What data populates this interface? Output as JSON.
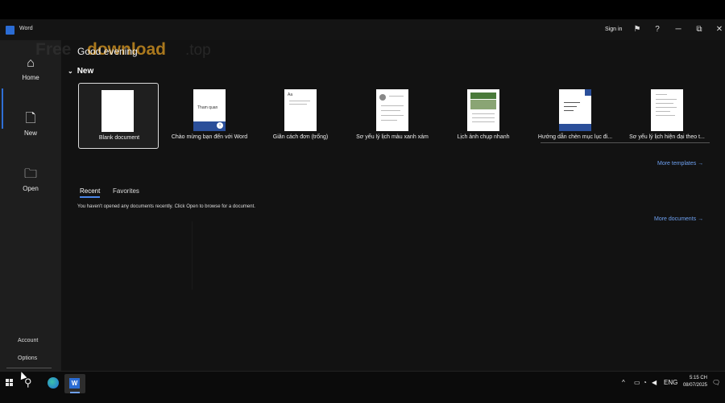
{
  "titlebar": {
    "app_name": "Word",
    "sign_in": "Sign in",
    "help_icon": "?",
    "minimize_icon": "─",
    "restore_icon": "⧉",
    "close_icon": "✕",
    "feedback_icon": "⚑"
  },
  "watermark": {
    "brand": "download",
    "prefix": "Free",
    "suffix": ".top"
  },
  "sidebar": {
    "items": [
      {
        "label": "Home",
        "icon": "home-icon",
        "glyph": "⌂"
      },
      {
        "label": "New",
        "icon": "new-document-icon",
        "glyph": "🗋"
      },
      {
        "label": "Open",
        "icon": "folder-icon",
        "glyph": "🗀"
      }
    ],
    "account": "Account",
    "options": "Options"
  },
  "main": {
    "greeting": "Good evening",
    "new_heading": "New",
    "new_chevron": "⌄",
    "templates": [
      {
        "name": "Blank document"
      },
      {
        "name": "Chào mừng bạn đến với Word",
        "thumb_text": "Tham quan"
      },
      {
        "name": "Giãn cách đơn (trống)",
        "thumb_text": "Aa"
      },
      {
        "name": "Sơ yếu lý lịch màu xanh xám"
      },
      {
        "name": "Lịch ảnh chụp nhanh"
      },
      {
        "name": "Hướng dẫn chèn mục lục đi..."
      },
      {
        "name": "Sơ yếu lý lịch hiện đại theo t..."
      }
    ],
    "more_templates": "More templates →",
    "tabs": [
      "Recent",
      "Favorites"
    ],
    "empty_message": "You haven't opened any documents recently. Click Open to browse for a document.",
    "more_documents": "More documents →"
  },
  "taskbar": {
    "search_glyph": "⚲",
    "word_glyph": "W",
    "tray_chevron": "^",
    "language": "ENG",
    "time": "5:15 CH",
    "date": "08/07/2025",
    "notification_glyph": "🗨"
  },
  "colors": {
    "accent": "#2f6fd6",
    "link": "#6ea0f0",
    "watermark": "#c58a1f",
    "background": "#121212",
    "sidebar": "#1e1e1e"
  }
}
